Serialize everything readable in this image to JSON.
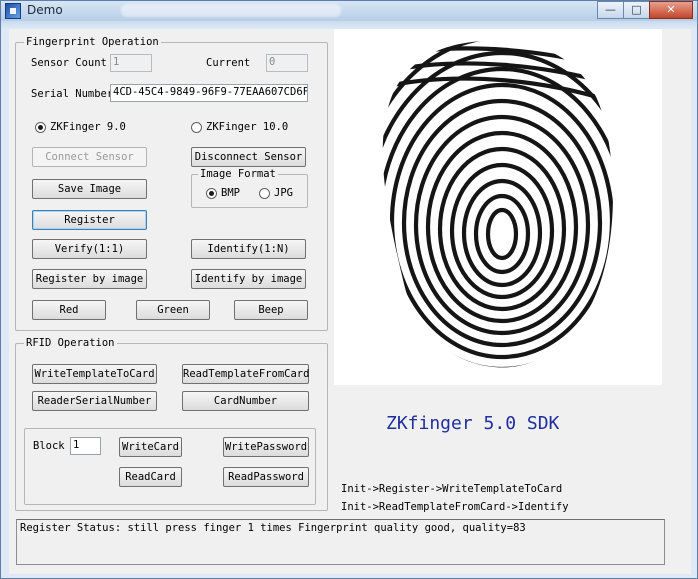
{
  "window": {
    "title": "Demo",
    "minimize": "—",
    "maximize": "□",
    "close": "✕"
  },
  "fingerprint": {
    "legend": "Fingerprint Operation",
    "sensor_count_label": "Sensor Count",
    "sensor_count_value": "1",
    "current_label": "Current",
    "current_value": "0",
    "serial_label": "Serial Number",
    "serial_value": "4CD-45C4-9849-96F9-77EAA607CD6F}",
    "zk9_label": "ZKFinger 9.0",
    "zk10_label": "ZKFinger 10.0",
    "connect_label": "Connect Sensor",
    "disconnect_label": "Disconnect Sensor",
    "save_image_label": "Save Image",
    "image_format_legend": "Image Format",
    "bmp_label": "BMP",
    "jpg_label": "JPG",
    "register_label": "Register",
    "verify_label": "Verify(1:1)",
    "identify_label": "Identify(1:N)",
    "register_by_image_label": "Register by image",
    "identify_by_image_label": "Identify by image",
    "red_label": "Red",
    "green_label": "Green",
    "beep_label": "Beep"
  },
  "rfid": {
    "legend": "RFID Operation",
    "write_template_label": "WriteTemplateToCard",
    "read_template_label": "ReadTemplateFromCard",
    "reader_serial_label": "ReaderSerialNumber",
    "card_number_label": "CardNumber",
    "block_label": "Block",
    "block_value": "1",
    "write_card_label": "WriteCard",
    "write_password_label": "WritePassword",
    "read_card_label": "ReadCard",
    "read_password_label": "ReadPassword"
  },
  "sdk_title": "ZKfinger  5.0 SDK",
  "hint_line1": "Init->Register->WriteTemplateToCard",
  "hint_line2": "Init->ReadTemplateFromCard->Identify",
  "status_text": "Register Status: still press finger 1 times Fingerprint quality good, quality=83",
  "colors": {
    "sdk_title": "#1e2e9e",
    "window_frame": "#5b7fa8",
    "close_button": "#c3452c"
  },
  "icons": [
    "app-icon",
    "fingerprint-image"
  ]
}
